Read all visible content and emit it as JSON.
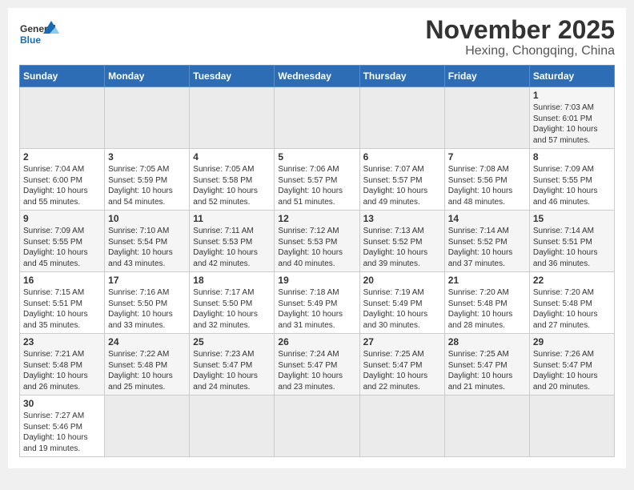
{
  "header": {
    "logo_general": "General",
    "logo_blue": "Blue",
    "month_title": "November 2025",
    "location": "Hexing, Chongqing, China"
  },
  "days_of_week": [
    "Sunday",
    "Monday",
    "Tuesday",
    "Wednesday",
    "Thursday",
    "Friday",
    "Saturday"
  ],
  "weeks": [
    [
      {
        "day": "",
        "info": ""
      },
      {
        "day": "",
        "info": ""
      },
      {
        "day": "",
        "info": ""
      },
      {
        "day": "",
        "info": ""
      },
      {
        "day": "",
        "info": ""
      },
      {
        "day": "",
        "info": ""
      },
      {
        "day": "1",
        "info": "Sunrise: 7:03 AM\nSunset: 6:01 PM\nDaylight: 10 hours and 57 minutes."
      }
    ],
    [
      {
        "day": "2",
        "info": "Sunrise: 7:04 AM\nSunset: 6:00 PM\nDaylight: 10 hours and 55 minutes."
      },
      {
        "day": "3",
        "info": "Sunrise: 7:05 AM\nSunset: 5:59 PM\nDaylight: 10 hours and 54 minutes."
      },
      {
        "day": "4",
        "info": "Sunrise: 7:05 AM\nSunset: 5:58 PM\nDaylight: 10 hours and 52 minutes."
      },
      {
        "day": "5",
        "info": "Sunrise: 7:06 AM\nSunset: 5:57 PM\nDaylight: 10 hours and 51 minutes."
      },
      {
        "day": "6",
        "info": "Sunrise: 7:07 AM\nSunset: 5:57 PM\nDaylight: 10 hours and 49 minutes."
      },
      {
        "day": "7",
        "info": "Sunrise: 7:08 AM\nSunset: 5:56 PM\nDaylight: 10 hours and 48 minutes."
      },
      {
        "day": "8",
        "info": "Sunrise: 7:09 AM\nSunset: 5:55 PM\nDaylight: 10 hours and 46 minutes."
      }
    ],
    [
      {
        "day": "9",
        "info": "Sunrise: 7:09 AM\nSunset: 5:55 PM\nDaylight: 10 hours and 45 minutes."
      },
      {
        "day": "10",
        "info": "Sunrise: 7:10 AM\nSunset: 5:54 PM\nDaylight: 10 hours and 43 minutes."
      },
      {
        "day": "11",
        "info": "Sunrise: 7:11 AM\nSunset: 5:53 PM\nDaylight: 10 hours and 42 minutes."
      },
      {
        "day": "12",
        "info": "Sunrise: 7:12 AM\nSunset: 5:53 PM\nDaylight: 10 hours and 40 minutes."
      },
      {
        "day": "13",
        "info": "Sunrise: 7:13 AM\nSunset: 5:52 PM\nDaylight: 10 hours and 39 minutes."
      },
      {
        "day": "14",
        "info": "Sunrise: 7:14 AM\nSunset: 5:52 PM\nDaylight: 10 hours and 37 minutes."
      },
      {
        "day": "15",
        "info": "Sunrise: 7:14 AM\nSunset: 5:51 PM\nDaylight: 10 hours and 36 minutes."
      }
    ],
    [
      {
        "day": "16",
        "info": "Sunrise: 7:15 AM\nSunset: 5:51 PM\nDaylight: 10 hours and 35 minutes."
      },
      {
        "day": "17",
        "info": "Sunrise: 7:16 AM\nSunset: 5:50 PM\nDaylight: 10 hours and 33 minutes."
      },
      {
        "day": "18",
        "info": "Sunrise: 7:17 AM\nSunset: 5:50 PM\nDaylight: 10 hours and 32 minutes."
      },
      {
        "day": "19",
        "info": "Sunrise: 7:18 AM\nSunset: 5:49 PM\nDaylight: 10 hours and 31 minutes."
      },
      {
        "day": "20",
        "info": "Sunrise: 7:19 AM\nSunset: 5:49 PM\nDaylight: 10 hours and 30 minutes."
      },
      {
        "day": "21",
        "info": "Sunrise: 7:20 AM\nSunset: 5:48 PM\nDaylight: 10 hours and 28 minutes."
      },
      {
        "day": "22",
        "info": "Sunrise: 7:20 AM\nSunset: 5:48 PM\nDaylight: 10 hours and 27 minutes."
      }
    ],
    [
      {
        "day": "23",
        "info": "Sunrise: 7:21 AM\nSunset: 5:48 PM\nDaylight: 10 hours and 26 minutes."
      },
      {
        "day": "24",
        "info": "Sunrise: 7:22 AM\nSunset: 5:48 PM\nDaylight: 10 hours and 25 minutes."
      },
      {
        "day": "25",
        "info": "Sunrise: 7:23 AM\nSunset: 5:47 PM\nDaylight: 10 hours and 24 minutes."
      },
      {
        "day": "26",
        "info": "Sunrise: 7:24 AM\nSunset: 5:47 PM\nDaylight: 10 hours and 23 minutes."
      },
      {
        "day": "27",
        "info": "Sunrise: 7:25 AM\nSunset: 5:47 PM\nDaylight: 10 hours and 22 minutes."
      },
      {
        "day": "28",
        "info": "Sunrise: 7:25 AM\nSunset: 5:47 PM\nDaylight: 10 hours and 21 minutes."
      },
      {
        "day": "29",
        "info": "Sunrise: 7:26 AM\nSunset: 5:47 PM\nDaylight: 10 hours and 20 minutes."
      }
    ],
    [
      {
        "day": "30",
        "info": "Sunrise: 7:27 AM\nSunset: 5:46 PM\nDaylight: 10 hours and 19 minutes."
      },
      {
        "day": "",
        "info": ""
      },
      {
        "day": "",
        "info": ""
      },
      {
        "day": "",
        "info": ""
      },
      {
        "day": "",
        "info": ""
      },
      {
        "day": "",
        "info": ""
      },
      {
        "day": "",
        "info": ""
      }
    ]
  ]
}
